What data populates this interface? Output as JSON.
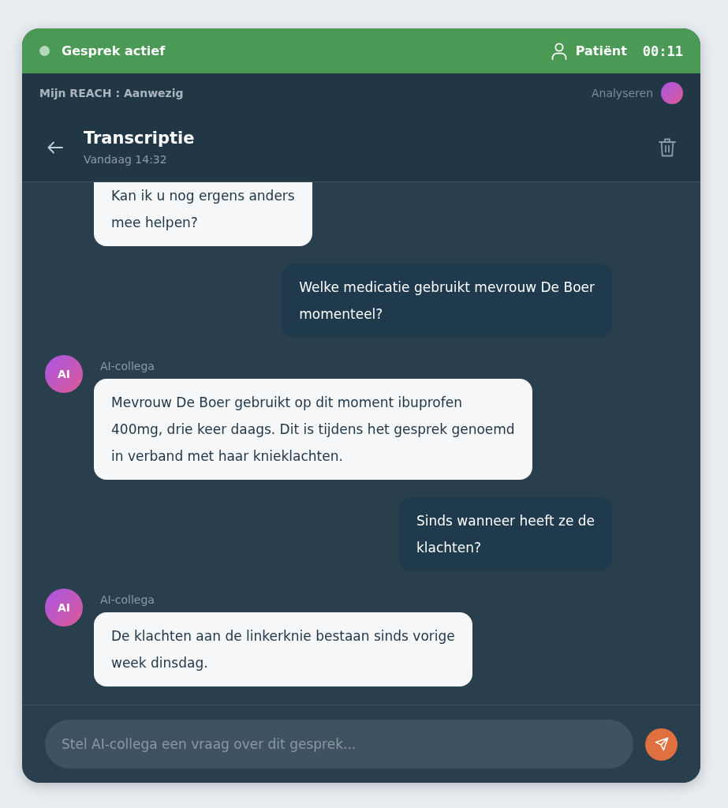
{
  "call_bar": {
    "status": "Gesprek actief",
    "role": "Patiënt",
    "timer": "00:11"
  },
  "presence_bar": {
    "label": "Mijn REACH : Aanwezig",
    "activity": "Analyseren"
  },
  "header": {
    "title": "Transcriptie",
    "subtitle": "Vandaag 14:32"
  },
  "messages": [
    {
      "kind": "assistant",
      "text": "Kan ik u nog ergens anders\nmee helpen?"
    },
    {
      "kind": "user",
      "text": "Welke medicatie gebruikt mevrouw De Boer\nmomenteel?"
    },
    {
      "kind": "assistant",
      "avatar": "AI",
      "sender": "AI-collega",
      "text": "Mevrouw De Boer gebruikt op dit moment ibuprofen\n400mg, drie keer daags. Dit is tijdens het gesprek genoemd\nin verband met haar knieklachten."
    },
    {
      "kind": "user",
      "text": "Sinds wanneer heeft ze de\nklachten?"
    },
    {
      "kind": "assistant",
      "avatar": "AI",
      "sender": "AI-collega",
      "text": "De klachten aan de linkerknie bestaan sinds vorige\nweek dinsdag."
    }
  ],
  "composer": {
    "placeholder": "Stel AI-collega een vraag over dit gesprek..."
  }
}
